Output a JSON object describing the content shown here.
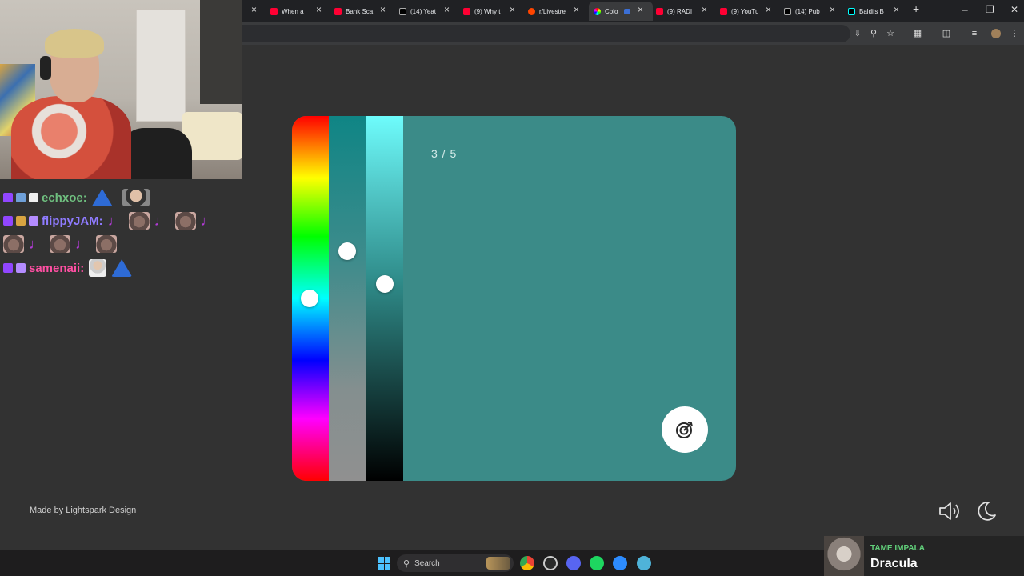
{
  "browser": {
    "tabs": [
      {
        "title": "When a l",
        "favicon_color": "#ff0033"
      },
      {
        "title": "Bank Sca",
        "favicon_color": "#ff0033"
      },
      {
        "title": "(14) Yeat",
        "favicon_color": "#000000"
      },
      {
        "title": "(9) Why t",
        "favicon_color": "#ff0033"
      },
      {
        "title": "r/Livestre",
        "favicon_color": "#ff4500"
      },
      {
        "title": "Colo",
        "favicon_color": "#c04ad8",
        "active": true
      },
      {
        "title": "(9) RADI",
        "favicon_color": "#ff0033"
      },
      {
        "title": "(9) YouTu",
        "favicon_color": "#ff0033"
      },
      {
        "title": "(14) Pub",
        "favicon_color": "#000000"
      },
      {
        "title": "Baldi's B",
        "favicon_color": "#000000"
      }
    ],
    "new_tab": "+",
    "close_glyph": "×"
  },
  "chat": {
    "messages": [
      {
        "user": "echxoe:",
        "color": "#6fbf7f"
      },
      {
        "user": "flippyJAM:",
        "color": "#8f7bff"
      },
      {
        "user": "samenaii:",
        "color": "#ff4fa3"
      }
    ]
  },
  "app": {
    "round_label": "3 / 5",
    "colors": {
      "card": "#3b8b88",
      "hue_selected": 0.5,
      "saturation_selected": 0.37,
      "lightness_selected": 0.46
    },
    "credit": "Made by Lightspark Design"
  },
  "taskbar": {
    "search_placeholder": "Search"
  },
  "now_playing": {
    "artist": "TAME IMPALA",
    "track": "Dracula"
  }
}
